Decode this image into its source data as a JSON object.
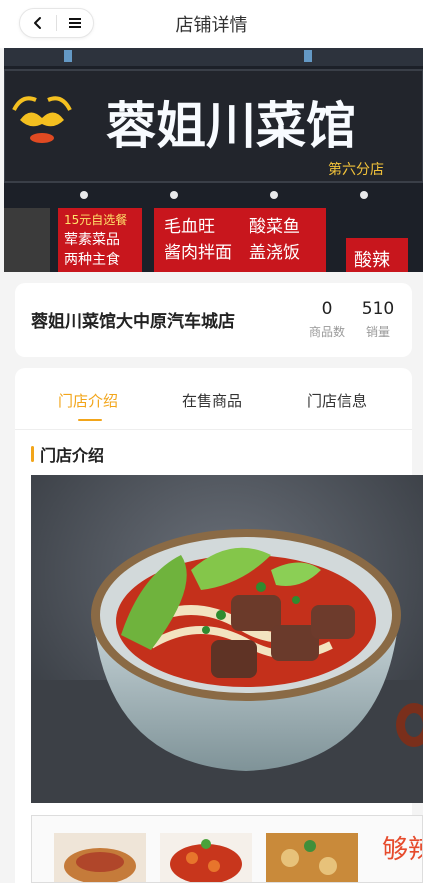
{
  "header": {
    "title": "店铺详情",
    "back_icon": "chevron-left-icon",
    "menu_icon": "menu-icon"
  },
  "banner": {
    "sign_text": "蓉姐川菜馆",
    "branch_text": "第六分店",
    "side_sign": [
      "15元自选餐",
      "荤素菜品",
      "两种主食"
    ],
    "menu_sign": [
      "毛血旺",
      "酸菜鱼",
      "酱肉拌面",
      "盖浇饭"
    ],
    "right_sign": "酸辣"
  },
  "store": {
    "name": "蓉姐川菜馆大中原汽车城店",
    "stats": [
      {
        "value": "0",
        "label": "商品数"
      },
      {
        "value": "510",
        "label": "销量"
      }
    ]
  },
  "tabs": [
    {
      "label": "门店介绍",
      "active": true
    },
    {
      "label": "在售商品",
      "active": false
    },
    {
      "label": "门店信息",
      "active": false
    }
  ],
  "intro": {
    "section_title": "门店介绍"
  },
  "thumbs": {
    "side_text": "够辣"
  },
  "colors": {
    "accent": "#f2a51a",
    "sign_red": "#c8161d"
  }
}
